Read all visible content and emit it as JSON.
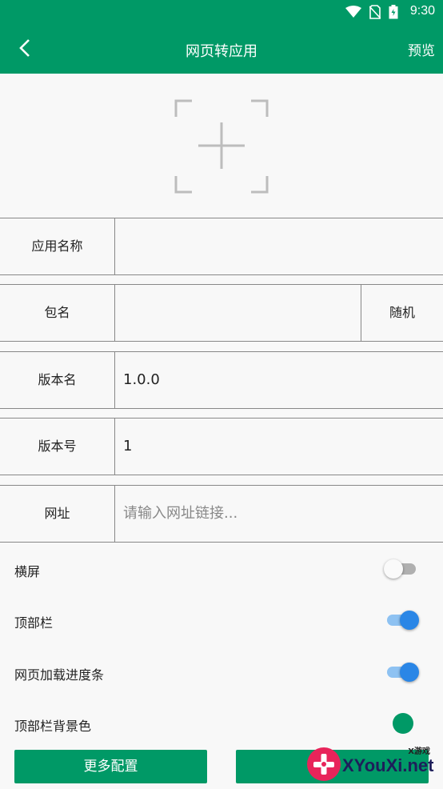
{
  "status_bar": {
    "time": "9:30"
  },
  "app_bar": {
    "title": "网页转应用",
    "preview_label": "预览"
  },
  "form": {
    "app_name": {
      "label": "应用名称",
      "value": ""
    },
    "package": {
      "label": "包名",
      "value": "",
      "random_label": "随机"
    },
    "version_name": {
      "label": "版本名",
      "value": "1.0.0"
    },
    "version_code": {
      "label": "版本号",
      "value": "1"
    },
    "url": {
      "label": "网址",
      "placeholder": "请输入网址链接..."
    }
  },
  "settings": {
    "landscape": {
      "label": "横屏",
      "enabled": false
    },
    "top_bar": {
      "label": "顶部栏",
      "enabled": true
    },
    "progress_bar": {
      "label": "网页加载进度条",
      "enabled": true
    },
    "top_bar_color": {
      "label": "顶部栏背景色",
      "color": "#009966"
    }
  },
  "buttons": {
    "more_config": "更多配置"
  },
  "watermark": {
    "small": "X游戏",
    "text": "XYouXi.net"
  },
  "colors": {
    "primary": "#009966",
    "switch_on": "#2a86e6"
  }
}
